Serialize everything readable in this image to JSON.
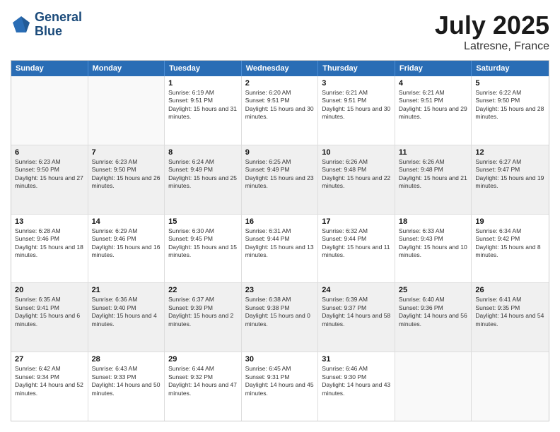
{
  "header": {
    "logo_line1": "General",
    "logo_line2": "Blue",
    "title": "July 2025",
    "subtitle": "Latresne, France"
  },
  "days": [
    "Sunday",
    "Monday",
    "Tuesday",
    "Wednesday",
    "Thursday",
    "Friday",
    "Saturday"
  ],
  "rows": [
    [
      {
        "day": "",
        "empty": true
      },
      {
        "day": "",
        "empty": true
      },
      {
        "day": "1",
        "rise": "Sunrise: 6:19 AM",
        "set": "Sunset: 9:51 PM",
        "daylight": "Daylight: 15 hours and 31 minutes."
      },
      {
        "day": "2",
        "rise": "Sunrise: 6:20 AM",
        "set": "Sunset: 9:51 PM",
        "daylight": "Daylight: 15 hours and 30 minutes."
      },
      {
        "day": "3",
        "rise": "Sunrise: 6:21 AM",
        "set": "Sunset: 9:51 PM",
        "daylight": "Daylight: 15 hours and 30 minutes."
      },
      {
        "day": "4",
        "rise": "Sunrise: 6:21 AM",
        "set": "Sunset: 9:51 PM",
        "daylight": "Daylight: 15 hours and 29 minutes."
      },
      {
        "day": "5",
        "rise": "Sunrise: 6:22 AM",
        "set": "Sunset: 9:50 PM",
        "daylight": "Daylight: 15 hours and 28 minutes."
      }
    ],
    [
      {
        "day": "6",
        "rise": "Sunrise: 6:23 AM",
        "set": "Sunset: 9:50 PM",
        "daylight": "Daylight: 15 hours and 27 minutes."
      },
      {
        "day": "7",
        "rise": "Sunrise: 6:23 AM",
        "set": "Sunset: 9:50 PM",
        "daylight": "Daylight: 15 hours and 26 minutes."
      },
      {
        "day": "8",
        "rise": "Sunrise: 6:24 AM",
        "set": "Sunset: 9:49 PM",
        "daylight": "Daylight: 15 hours and 25 minutes."
      },
      {
        "day": "9",
        "rise": "Sunrise: 6:25 AM",
        "set": "Sunset: 9:49 PM",
        "daylight": "Daylight: 15 hours and 23 minutes."
      },
      {
        "day": "10",
        "rise": "Sunrise: 6:26 AM",
        "set": "Sunset: 9:48 PM",
        "daylight": "Daylight: 15 hours and 22 minutes."
      },
      {
        "day": "11",
        "rise": "Sunrise: 6:26 AM",
        "set": "Sunset: 9:48 PM",
        "daylight": "Daylight: 15 hours and 21 minutes."
      },
      {
        "day": "12",
        "rise": "Sunrise: 6:27 AM",
        "set": "Sunset: 9:47 PM",
        "daylight": "Daylight: 15 hours and 19 minutes."
      }
    ],
    [
      {
        "day": "13",
        "rise": "Sunrise: 6:28 AM",
        "set": "Sunset: 9:46 PM",
        "daylight": "Daylight: 15 hours and 18 minutes."
      },
      {
        "day": "14",
        "rise": "Sunrise: 6:29 AM",
        "set": "Sunset: 9:46 PM",
        "daylight": "Daylight: 15 hours and 16 minutes."
      },
      {
        "day": "15",
        "rise": "Sunrise: 6:30 AM",
        "set": "Sunset: 9:45 PM",
        "daylight": "Daylight: 15 hours and 15 minutes."
      },
      {
        "day": "16",
        "rise": "Sunrise: 6:31 AM",
        "set": "Sunset: 9:44 PM",
        "daylight": "Daylight: 15 hours and 13 minutes."
      },
      {
        "day": "17",
        "rise": "Sunrise: 6:32 AM",
        "set": "Sunset: 9:44 PM",
        "daylight": "Daylight: 15 hours and 11 minutes."
      },
      {
        "day": "18",
        "rise": "Sunrise: 6:33 AM",
        "set": "Sunset: 9:43 PM",
        "daylight": "Daylight: 15 hours and 10 minutes."
      },
      {
        "day": "19",
        "rise": "Sunrise: 6:34 AM",
        "set": "Sunset: 9:42 PM",
        "daylight": "Daylight: 15 hours and 8 minutes."
      }
    ],
    [
      {
        "day": "20",
        "rise": "Sunrise: 6:35 AM",
        "set": "Sunset: 9:41 PM",
        "daylight": "Daylight: 15 hours and 6 minutes."
      },
      {
        "day": "21",
        "rise": "Sunrise: 6:36 AM",
        "set": "Sunset: 9:40 PM",
        "daylight": "Daylight: 15 hours and 4 minutes."
      },
      {
        "day": "22",
        "rise": "Sunrise: 6:37 AM",
        "set": "Sunset: 9:39 PM",
        "daylight": "Daylight: 15 hours and 2 minutes."
      },
      {
        "day": "23",
        "rise": "Sunrise: 6:38 AM",
        "set": "Sunset: 9:38 PM",
        "daylight": "Daylight: 15 hours and 0 minutes."
      },
      {
        "day": "24",
        "rise": "Sunrise: 6:39 AM",
        "set": "Sunset: 9:37 PM",
        "daylight": "Daylight: 14 hours and 58 minutes."
      },
      {
        "day": "25",
        "rise": "Sunrise: 6:40 AM",
        "set": "Sunset: 9:36 PM",
        "daylight": "Daylight: 14 hours and 56 minutes."
      },
      {
        "day": "26",
        "rise": "Sunrise: 6:41 AM",
        "set": "Sunset: 9:35 PM",
        "daylight": "Daylight: 14 hours and 54 minutes."
      }
    ],
    [
      {
        "day": "27",
        "rise": "Sunrise: 6:42 AM",
        "set": "Sunset: 9:34 PM",
        "daylight": "Daylight: 14 hours and 52 minutes."
      },
      {
        "day": "28",
        "rise": "Sunrise: 6:43 AM",
        "set": "Sunset: 9:33 PM",
        "daylight": "Daylight: 14 hours and 50 minutes."
      },
      {
        "day": "29",
        "rise": "Sunrise: 6:44 AM",
        "set": "Sunset: 9:32 PM",
        "daylight": "Daylight: 14 hours and 47 minutes."
      },
      {
        "day": "30",
        "rise": "Sunrise: 6:45 AM",
        "set": "Sunset: 9:31 PM",
        "daylight": "Daylight: 14 hours and 45 minutes."
      },
      {
        "day": "31",
        "rise": "Sunrise: 6:46 AM",
        "set": "Sunset: 9:30 PM",
        "daylight": "Daylight: 14 hours and 43 minutes."
      },
      {
        "day": "",
        "empty": true
      },
      {
        "day": "",
        "empty": true
      }
    ]
  ]
}
